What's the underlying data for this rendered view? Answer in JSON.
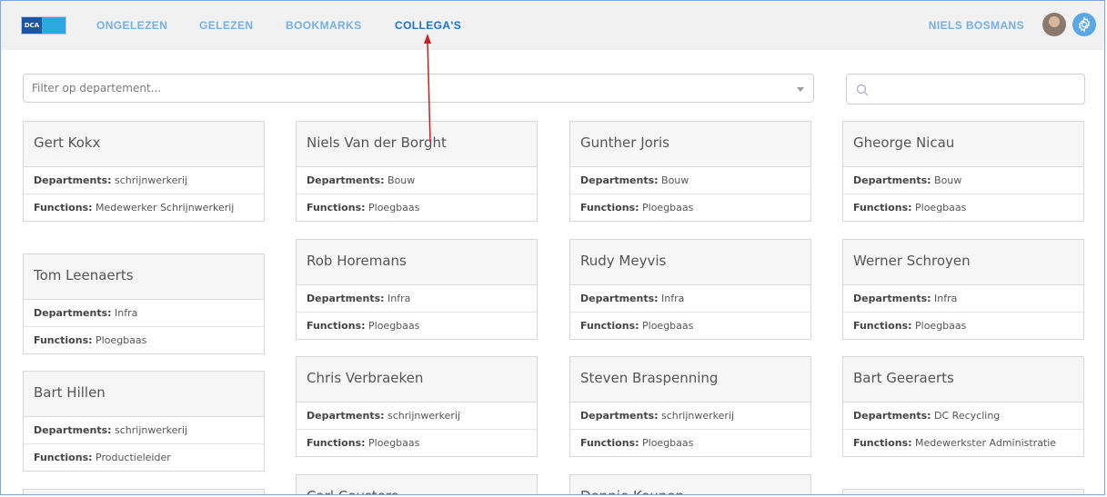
{
  "logo": {
    "text": "DCA"
  },
  "nav": {
    "items": [
      {
        "label": "ONGELEZEN"
      },
      {
        "label": "GELEZEN"
      },
      {
        "label": "BOOKMARKS"
      },
      {
        "label": "COLLEGA'S"
      }
    ],
    "active": "COLLEGA'S",
    "active_color": "#2373c6",
    "inactive_color": "#7ab0dd"
  },
  "user": {
    "name": "NIELS BOSMANS"
  },
  "filter": {
    "placeholder": "Filter op departement..."
  },
  "search": {
    "placeholder": "",
    "value": ""
  },
  "labels": {
    "departments": "Departments:",
    "functions": "Functions:"
  },
  "columns": [
    [
      {
        "name": "Gert Kokx",
        "department": "schrijnwerkerij",
        "function": "Medewerker Schrijnwerkerij"
      },
      {
        "name": "Tom Leenaerts",
        "department": "Infra",
        "function": "Ploegbaas"
      },
      {
        "name": "Bart Hillen",
        "department": "schrijnwerkerij",
        "function": "Productieleider"
      }
    ],
    [
      {
        "name": "Niels Van der Borght",
        "department": "Bouw",
        "function": "Ploegbaas"
      },
      {
        "name": "Rob Horemans",
        "department": "Infra",
        "function": "Ploegbaas"
      },
      {
        "name": "Chris Verbraeken",
        "department": "schrijnwerkerij",
        "function": "Ploegbaas"
      },
      {
        "name": "Carl Ceusters",
        "department": "",
        "function": ""
      }
    ],
    [
      {
        "name": "Gunther Joris",
        "department": "Bouw",
        "function": "Ploegbaas"
      },
      {
        "name": "Rudy Meyvis",
        "department": "Infra",
        "function": "Ploegbaas"
      },
      {
        "name": "Steven Braspenning",
        "department": "schrijnwerkerij",
        "function": "Ploegbaas"
      },
      {
        "name": "Dennie Keunen",
        "department": "",
        "function": ""
      }
    ],
    [
      {
        "name": "Gheorge Nicau",
        "department": "Bouw",
        "function": "Ploegbaas"
      },
      {
        "name": "Werner Schroyen",
        "department": "Infra",
        "function": "Ploegbaas"
      },
      {
        "name": "Bart Geeraerts",
        "department": "DC Recycling",
        "function": "Medewerkster Administratie"
      }
    ]
  ],
  "accent_color": "#cc1f1f"
}
